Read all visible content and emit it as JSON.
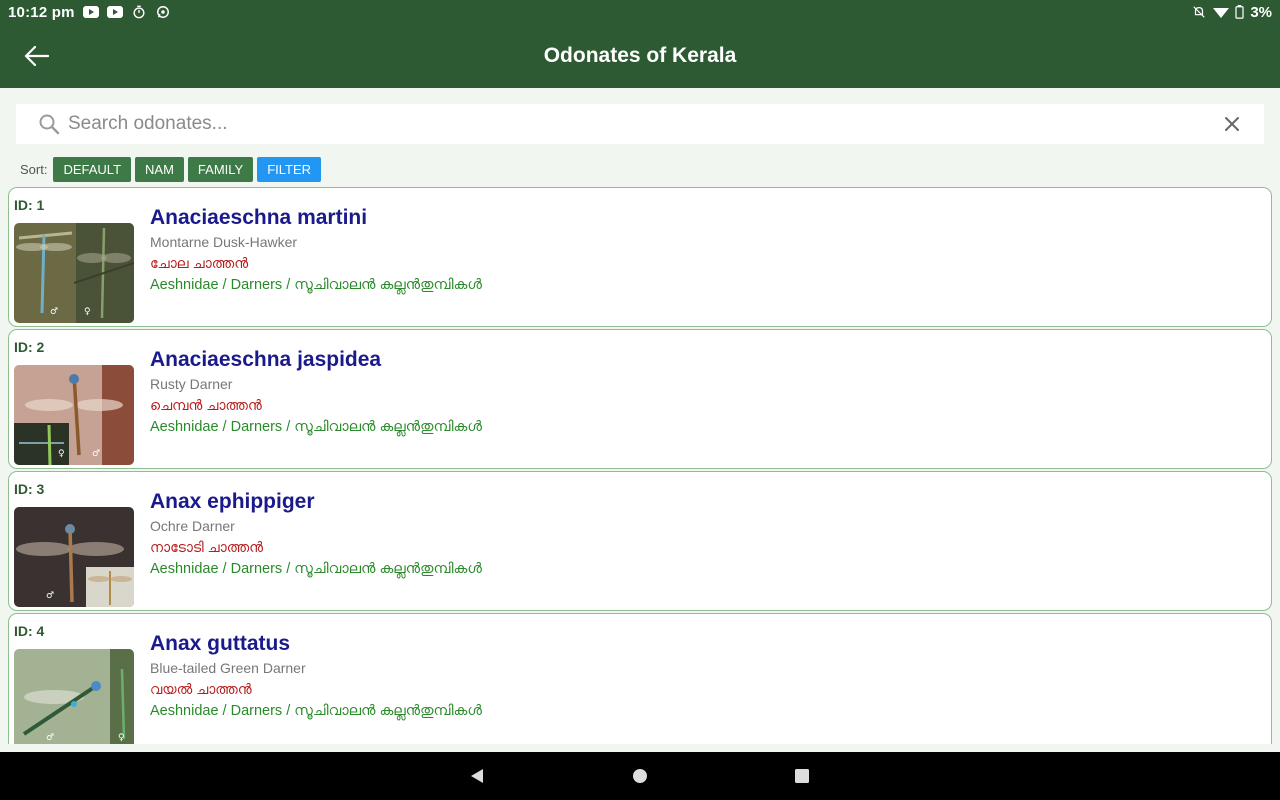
{
  "status_bar": {
    "time": "10:12 pm",
    "battery": "3%"
  },
  "app_bar": {
    "title": "Odonates of Kerala",
    "back_icon": "arrow-left-icon"
  },
  "search": {
    "placeholder": "Search odonates...",
    "value": ""
  },
  "sort": {
    "label": "Sort:",
    "buttons": [
      {
        "label": "DEFAULT",
        "color": "#3d7a47"
      },
      {
        "label": "NAM",
        "color": "#3d7a47"
      },
      {
        "label": "FAMILY",
        "color": "#3d7a47"
      },
      {
        "label": "FILTER",
        "color": "#2196f3"
      }
    ]
  },
  "species": [
    {
      "id": "ID: 1",
      "scientific": "Anaciaeschna martini",
      "common": "Montarne Dusk-Hawker",
      "malayalam": "ചോല ചാത്തൻ",
      "family": "Aeshnidae / Darners / സൂചിവാലൻ കല്ലൻതുമ്പികൾ"
    },
    {
      "id": "ID: 2",
      "scientific": "Anaciaeschna jaspidea",
      "common": "Rusty Darner",
      "malayalam": "ചെമ്പൻ ചാത്തൻ",
      "family": "Aeshnidae / Darners / സൂചിവാലൻ കല്ലൻതുമ്പികൾ"
    },
    {
      "id": "ID: 3",
      "scientific": "Anax ephippiger",
      "common": "Ochre Darner",
      "malayalam": "നാടോടി ചാത്തൻ",
      "family": "Aeshnidae / Darners / സൂചിവാലൻ കല്ലൻതുമ്പികൾ"
    },
    {
      "id": "ID: 4",
      "scientific": "Anax guttatus",
      "common": "Blue-tailed Green Darner",
      "malayalam": "വയൽ ചാത്തൻ",
      "family": "Aeshnidae / Darners / സൂചിവാലൻ കല്ലൻതുമ്പികൾ"
    }
  ],
  "colors": {
    "primary": "#2e5a33",
    "scientific_name": "#1a1a8c",
    "malayalam_name": "#b71c1c",
    "family": "#2a8a2a",
    "filter": "#2196f3"
  },
  "nav_bar": {
    "icons": [
      "back-triangle-icon",
      "home-circle-icon",
      "recents-square-icon"
    ]
  }
}
